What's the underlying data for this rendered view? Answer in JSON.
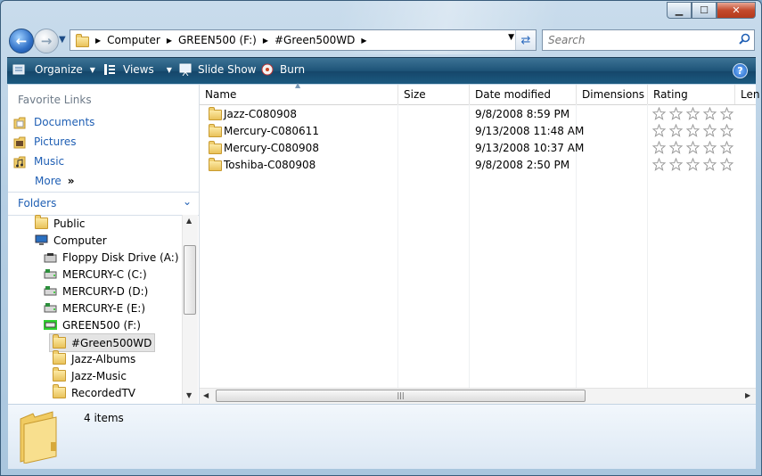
{
  "address": {
    "crumbs": [
      "Computer",
      "GREEN500 (F:)",
      "#Green500WD"
    ]
  },
  "search": {
    "placeholder": "Search"
  },
  "toolbar": {
    "organize": "Organize",
    "views": "Views",
    "slideshow": "Slide Show",
    "burn": "Burn"
  },
  "nav": {
    "favorites_title": "Favorite Links",
    "favorites": [
      "Documents",
      "Pictures",
      "Music"
    ],
    "more": "More",
    "folders_title": "Folders",
    "tree": [
      {
        "label": "Public",
        "icon": "folder-icon"
      },
      {
        "label": "Computer",
        "icon": "computer-icon"
      },
      {
        "label": "Floppy Disk Drive (A:)",
        "icon": "floppy-drive-icon"
      },
      {
        "label": "MERCURY-C (C:)",
        "icon": "hard-drive-icon"
      },
      {
        "label": "MERCURY-D (D:)",
        "icon": "hard-drive-icon"
      },
      {
        "label": "MERCURY-E (E:)",
        "icon": "hard-drive-icon"
      },
      {
        "label": "GREEN500 (F:)",
        "icon": "usb-drive-icon"
      },
      {
        "label": "#Green500WD",
        "icon": "folder-icon"
      },
      {
        "label": "Jazz-Albums",
        "icon": "folder-icon"
      },
      {
        "label": "Jazz-Music",
        "icon": "folder-icon"
      },
      {
        "label": "RecordedTV",
        "icon": "folder-icon"
      }
    ]
  },
  "columns": [
    "Name",
    "Size",
    "Date modified",
    "Dimensions",
    "Rating",
    "Len"
  ],
  "files": [
    {
      "name": "Jazz-C080908",
      "date": "9/8/2008 8:59 PM"
    },
    {
      "name": "Mercury-C080611",
      "date": "9/13/2008 11:48 AM"
    },
    {
      "name": "Mercury-C080908",
      "date": "9/13/2008 10:37 AM"
    },
    {
      "name": "Toshiba-C080908",
      "date": "9/8/2008 2:50 PM"
    }
  ],
  "details": {
    "count": "4 items"
  },
  "colors": {
    "toolbar": "#1e5478",
    "link": "#1f5fb4",
    "usb_accent": "#2fd12f"
  }
}
